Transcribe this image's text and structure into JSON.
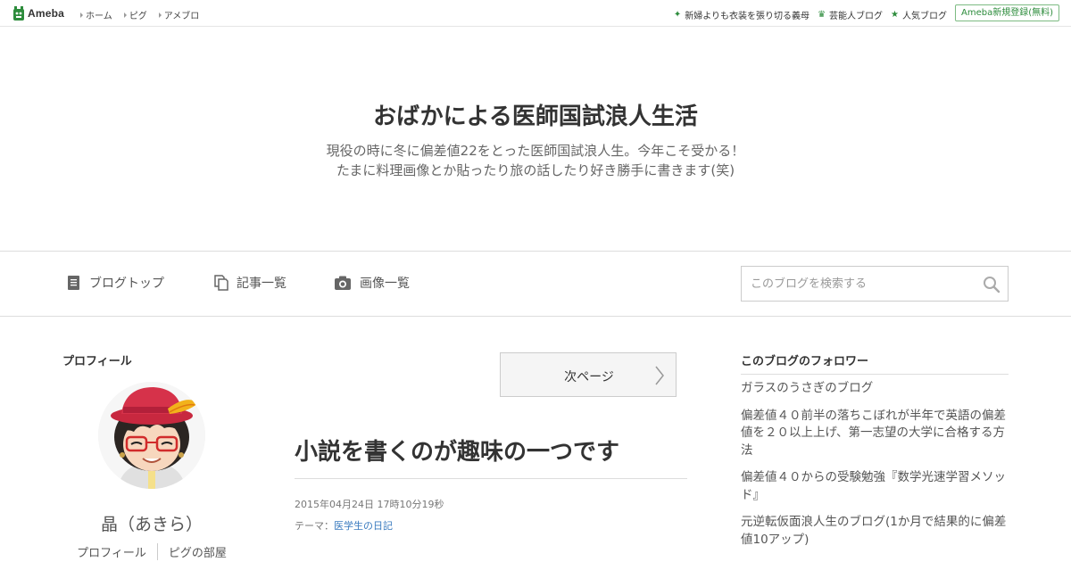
{
  "topbar": {
    "logo_text": "Ameba",
    "nav": [
      {
        "label": "ホーム"
      },
      {
        "label": "ピグ"
      },
      {
        "label": "アメブロ"
      }
    ],
    "right_links": [
      {
        "icon": "sparkle-icon",
        "label": "新婦よりも衣装を張り切る義母"
      },
      {
        "icon": "crown-icon",
        "label": "芸能人ブログ"
      },
      {
        "icon": "star-icon",
        "label": "人気ブログ"
      }
    ],
    "signup_label": "Ameba新規登録(無料)",
    "accent_color": "#2d8c3c"
  },
  "header": {
    "title": "おばかによる医師国試浪人生活",
    "description_line1": "現役の時に冬に偏差値22をとった医師国試浪人生。今年こそ受かる！",
    "description_line2": "たまに料理画像とか貼ったり旅の話したり好き勝手に書きます(笑)"
  },
  "blognav": {
    "links": [
      {
        "icon": "document-icon",
        "label": "ブログトップ"
      },
      {
        "icon": "copy-icon",
        "label": "記事一覧"
      },
      {
        "icon": "camera-icon",
        "label": "画像一覧"
      }
    ],
    "search_placeholder": "このブログを検索する"
  },
  "profile": {
    "heading": "プロフィール",
    "name": "晶（あきら）",
    "links": [
      "プロフィール",
      "ピグの部屋"
    ]
  },
  "main": {
    "next_page_label": "次ページ",
    "entry": {
      "title": "小説を書くのが趣味の一つです",
      "date": "2015年04月24日 17時10分19秒",
      "theme_prefix": "テーマ：",
      "theme": "医学生の日記"
    }
  },
  "followers": {
    "heading": "このブログのフォロワー",
    "items": [
      "ガラスのうさぎのブログ",
      "偏差値４０前半の落ちこぼれが半年で英語の偏差値を２０以上上げ、第一志望の大学に合格する方法",
      "偏差値４０からの受験勉強『数学光速学習メソッド』",
      "元逆転仮面浪人生のブログ(1か月で結果的に偏差値10アップ)"
    ]
  }
}
